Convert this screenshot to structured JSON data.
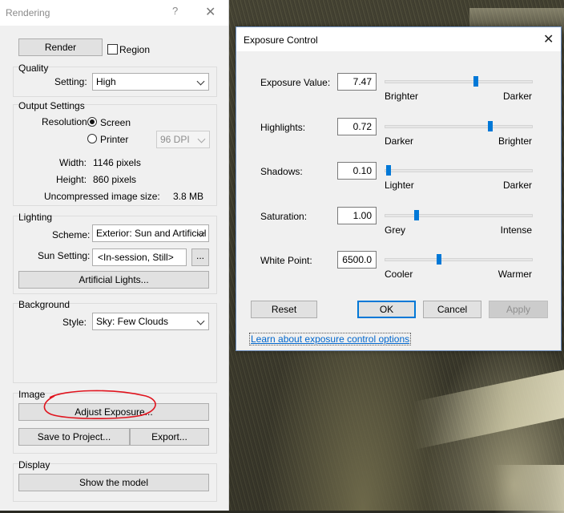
{
  "rendering_panel": {
    "title": "Rendering",
    "help_icon": "?",
    "close_icon": "✕",
    "render_button": "Render",
    "region_label": "Region",
    "region_checked": false,
    "quality": {
      "group_label": "Quality",
      "setting_label": "Setting:",
      "setting_value": "High"
    },
    "output": {
      "group_label": "Output Settings",
      "resolution_label": "Resolution:",
      "screen_label": "Screen",
      "printer_label": "Printer",
      "selected": "Screen",
      "dpi_value": "96 DPI",
      "width_label": "Width:",
      "width_value": "1146 pixels",
      "height_label": "Height:",
      "height_value": "860 pixels",
      "size_label": "Uncompressed image size:",
      "size_value": "3.8 MB"
    },
    "lighting": {
      "group_label": "Lighting",
      "scheme_label": "Scheme:",
      "scheme_value": "Exterior: Sun and Artificial",
      "sun_label": "Sun Setting:",
      "sun_value": "<In-session, Still>",
      "sun_browse": "...",
      "artificial_button": "Artificial Lights..."
    },
    "background": {
      "group_label": "Background",
      "style_label": "Style:",
      "style_value": "Sky: Few Clouds"
    },
    "image": {
      "group_label": "Image",
      "adjust_button": "Adjust Exposure...",
      "save_button": "Save to Project...",
      "export_button": "Export..."
    },
    "display": {
      "group_label": "Display",
      "show_button": "Show the model"
    }
  },
  "exposure_dialog": {
    "title": "Exposure Control",
    "close_icon": "✕",
    "rows": [
      {
        "label": "Exposure Value:",
        "value": "7.47",
        "left": "Brighter",
        "right": "Darker",
        "slider_fraction": 0.61
      },
      {
        "label": "Highlights:",
        "value": "0.72",
        "left": "Darker",
        "right": "Brighter",
        "slider_fraction": 0.71
      },
      {
        "label": "Shadows:",
        "value": "0.10",
        "left": "Lighter",
        "right": "Darker",
        "slider_fraction": 0.02
      },
      {
        "label": "Saturation:",
        "value": "1.00",
        "left": "Grey",
        "right": "Intense",
        "slider_fraction": 0.21
      },
      {
        "label": "White Point:",
        "value": "6500.0",
        "left": "Cooler",
        "right": "Warmer",
        "slider_fraction": 0.36
      }
    ],
    "reset_button": "Reset",
    "ok_button": "OK",
    "cancel_button": "Cancel",
    "apply_button": "Apply",
    "help_link": "Learn about exposure control options"
  },
  "colors": {
    "accent": "#0078d7",
    "annotation": "#e0141e",
    "link": "#0066cc"
  }
}
